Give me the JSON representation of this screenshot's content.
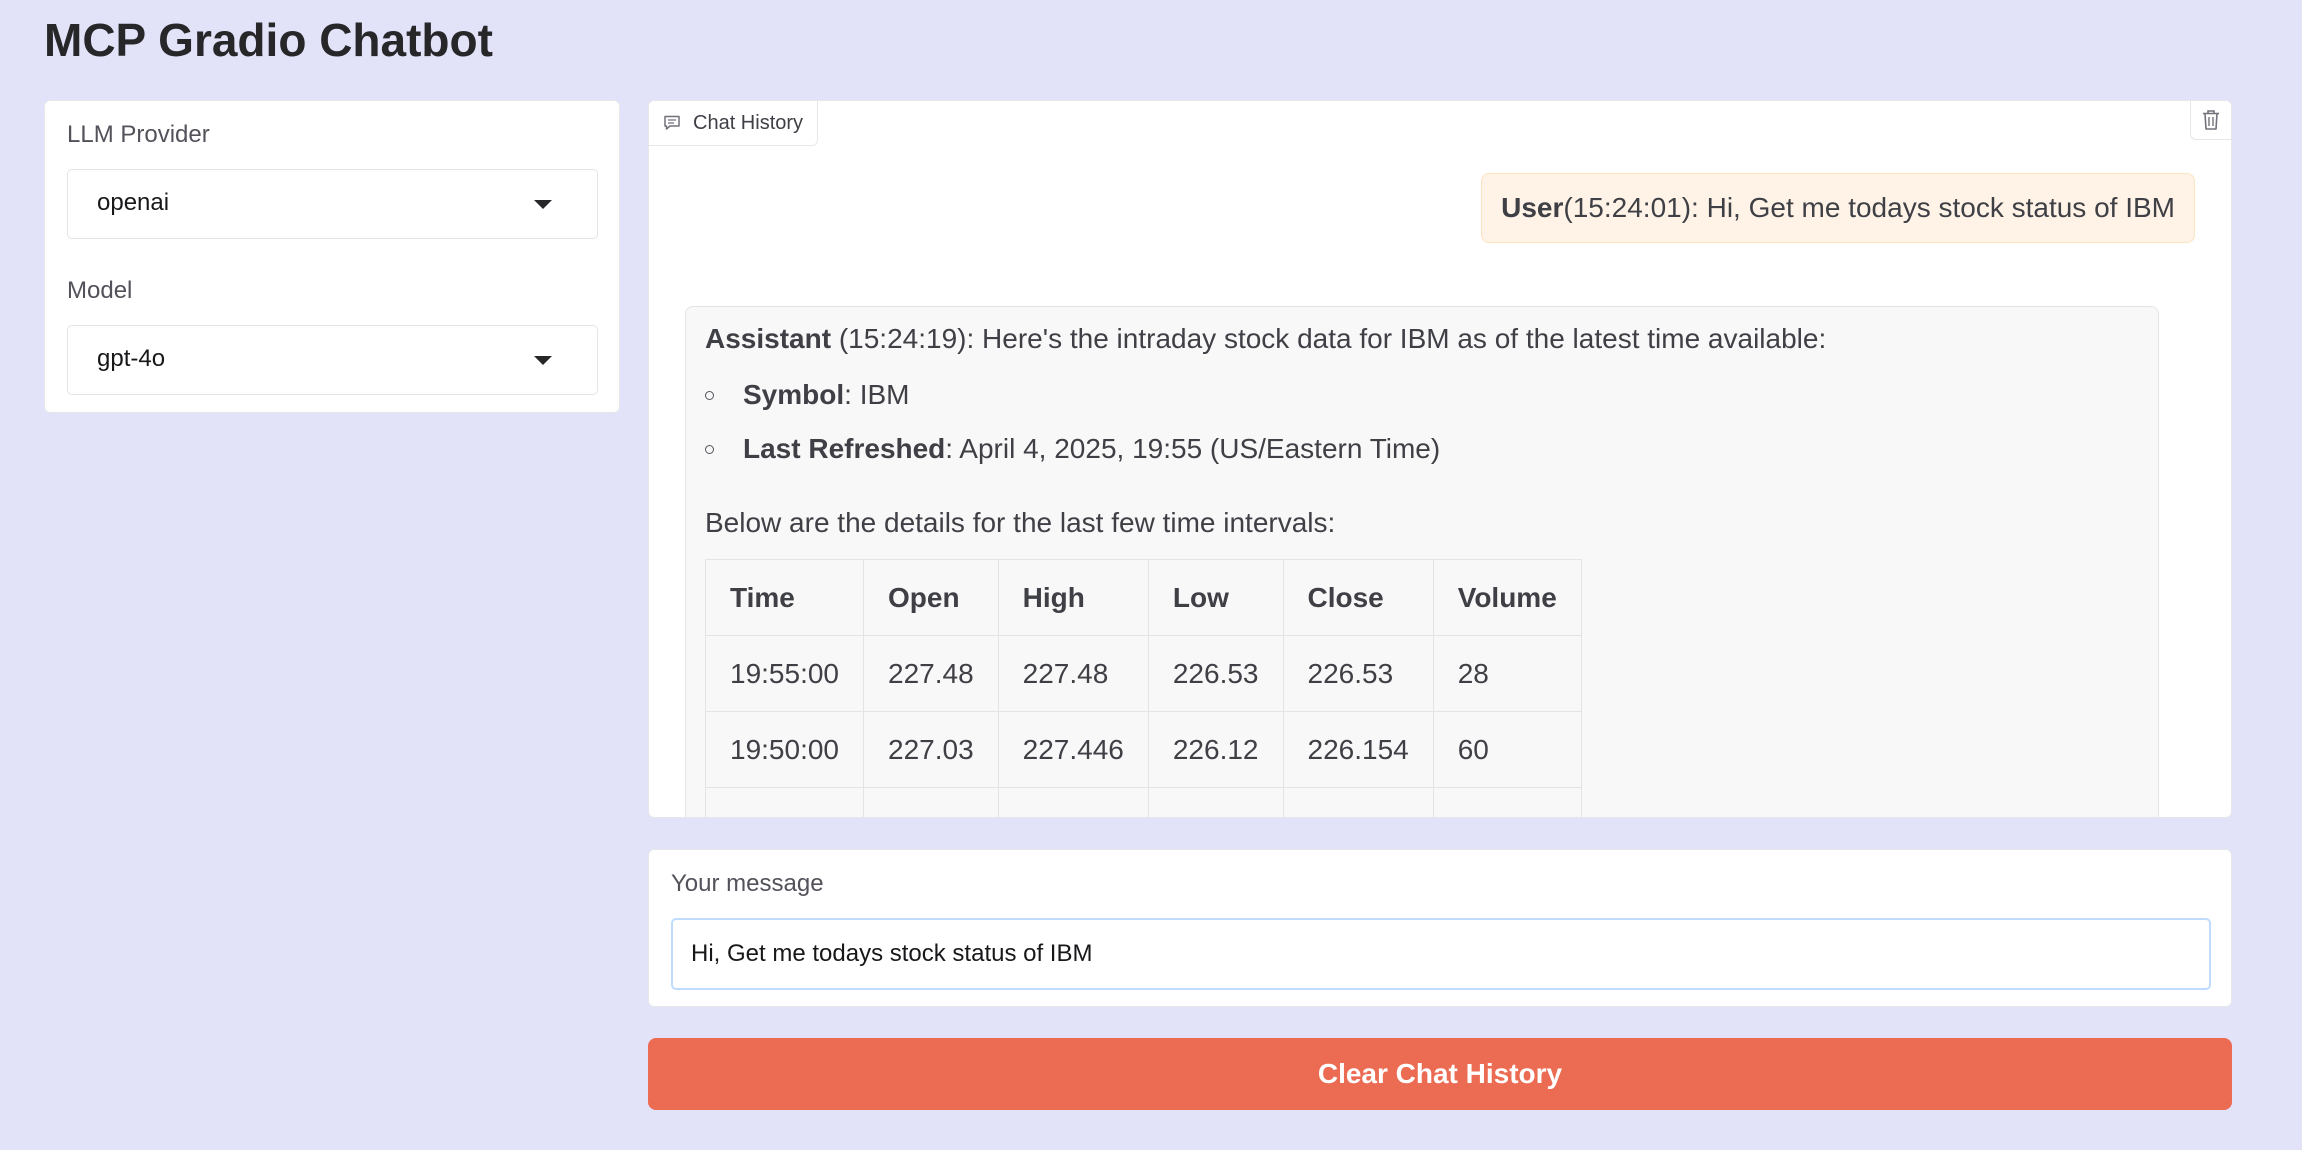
{
  "app": {
    "title": "MCP Gradio Chatbot"
  },
  "sidebar": {
    "provider_label": "LLM Provider",
    "provider_value": "openai",
    "model_label": "Model",
    "model_value": "gpt-4o"
  },
  "chat": {
    "label": "Chat History",
    "user_message": {
      "role": "User",
      "time": " (15:24:01)",
      "text": ": Hi, Get me todays stock status of IBM"
    },
    "assistant_message": {
      "role": "Assistant",
      "time": " (15:24:19)",
      "text": ": Here's the intraday stock data for IBM as of the latest time available:",
      "bullets": [
        {
          "key": "Symbol",
          "value": ": IBM"
        },
        {
          "key": "Last Refreshed",
          "value": ": April 4, 2025, 19:55 (US/Eastern Time)"
        }
      ],
      "details_intro": "Below are the details for the last few time intervals:",
      "table": {
        "headers": [
          "Time",
          "Open",
          "High",
          "Low",
          "Close",
          "Volume"
        ],
        "rows": [
          [
            "19:55:00",
            "227.48",
            "227.48",
            "226.53",
            "226.53",
            "28"
          ],
          [
            "19:50:00",
            "227.03",
            "227.446",
            "226.12",
            "226.154",
            "60"
          ]
        ]
      }
    }
  },
  "message": {
    "label": "Your message",
    "value": "Hi, Get me todays stock status of IBM"
  },
  "actions": {
    "clear_label": "Clear Chat History"
  },
  "colors": {
    "background": "#e2e3f8",
    "accent_button": "#ec6b53",
    "user_bubble": "#fef3e6",
    "assistant_bubble": "#f8f8f8"
  },
  "icons": {
    "chat_label_icon": "chat-bubble-icon",
    "clear_icon": "trash-icon",
    "dropdown_icon": "caret-down-icon"
  }
}
